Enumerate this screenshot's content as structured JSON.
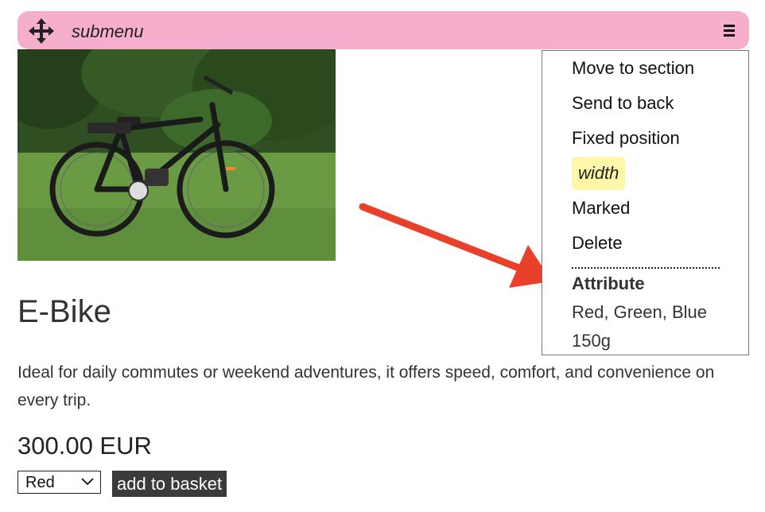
{
  "topbar": {
    "title": "submenu",
    "move_icon": "move-arrows-icon",
    "menu_icon": "hamburger-menu-icon",
    "background_color": "#f5aecb"
  },
  "menu": {
    "items": [
      "Move to section",
      "Send to back",
      "Fixed position",
      "width",
      "Marked",
      "Delete"
    ],
    "highlight_color": "#fff7a8",
    "attribute_heading": "Attribute",
    "attribute_values": [
      "Red, Green, Blue",
      "150g"
    ]
  },
  "annotation": {
    "arrow_color": "#e8402a"
  },
  "product": {
    "name": "E-Bike",
    "description": "Ideal for daily commutes or weekend adventures, it offers speed, comfort, and convenience on every trip.",
    "price": "300.00 EUR",
    "select_value": "Red",
    "add_button": "add to basket"
  }
}
